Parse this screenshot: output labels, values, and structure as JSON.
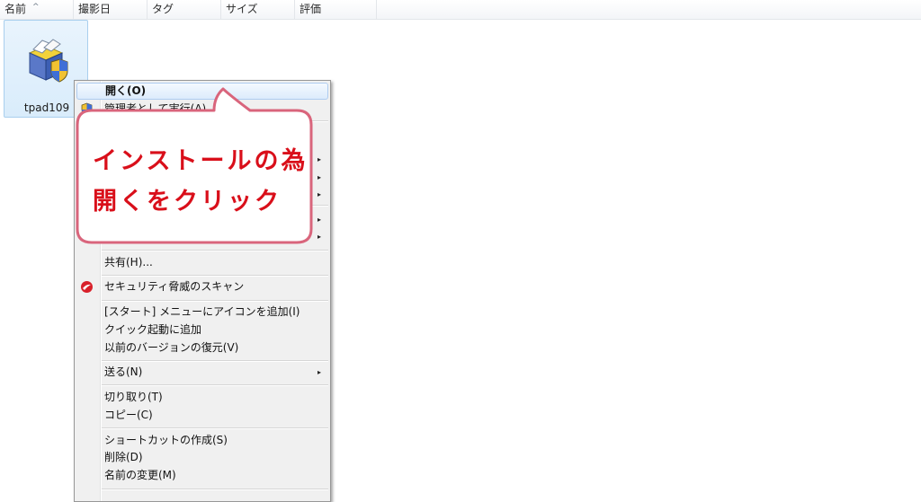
{
  "columns": [
    {
      "label": "名前"
    },
    {
      "label": "撮影日"
    },
    {
      "label": "タグ"
    },
    {
      "label": "サイズ"
    },
    {
      "label": "評価"
    }
  ],
  "sort_indicator": "^",
  "file": {
    "name": "tpad109",
    "icon": "installer-package-icon"
  },
  "menu": {
    "open": "開く(O)",
    "run_as_admin": "管理者として実行(A)",
    "share": "共有(H)...",
    "scan": "セキュリティ脅威のスキャン",
    "pin_start": "[スタート] メニューにアイコンを追加(I)",
    "quick_launch": "クイック起動に追加",
    "restore": "以前のバージョンの復元(V)",
    "send_to": "送る(N)",
    "cut": "切り取り(T)",
    "copy": "コピー(C)",
    "shortcut": "ショートカットの作成(S)",
    "delete": "削除(D)",
    "rename": "名前の変更(M)",
    "submenu_arrow": "▸"
  },
  "callout": {
    "line1": "インストールの為",
    "line2": "開くをクリック",
    "border_color": "#d9657c",
    "text_color": "#d90f1a"
  }
}
